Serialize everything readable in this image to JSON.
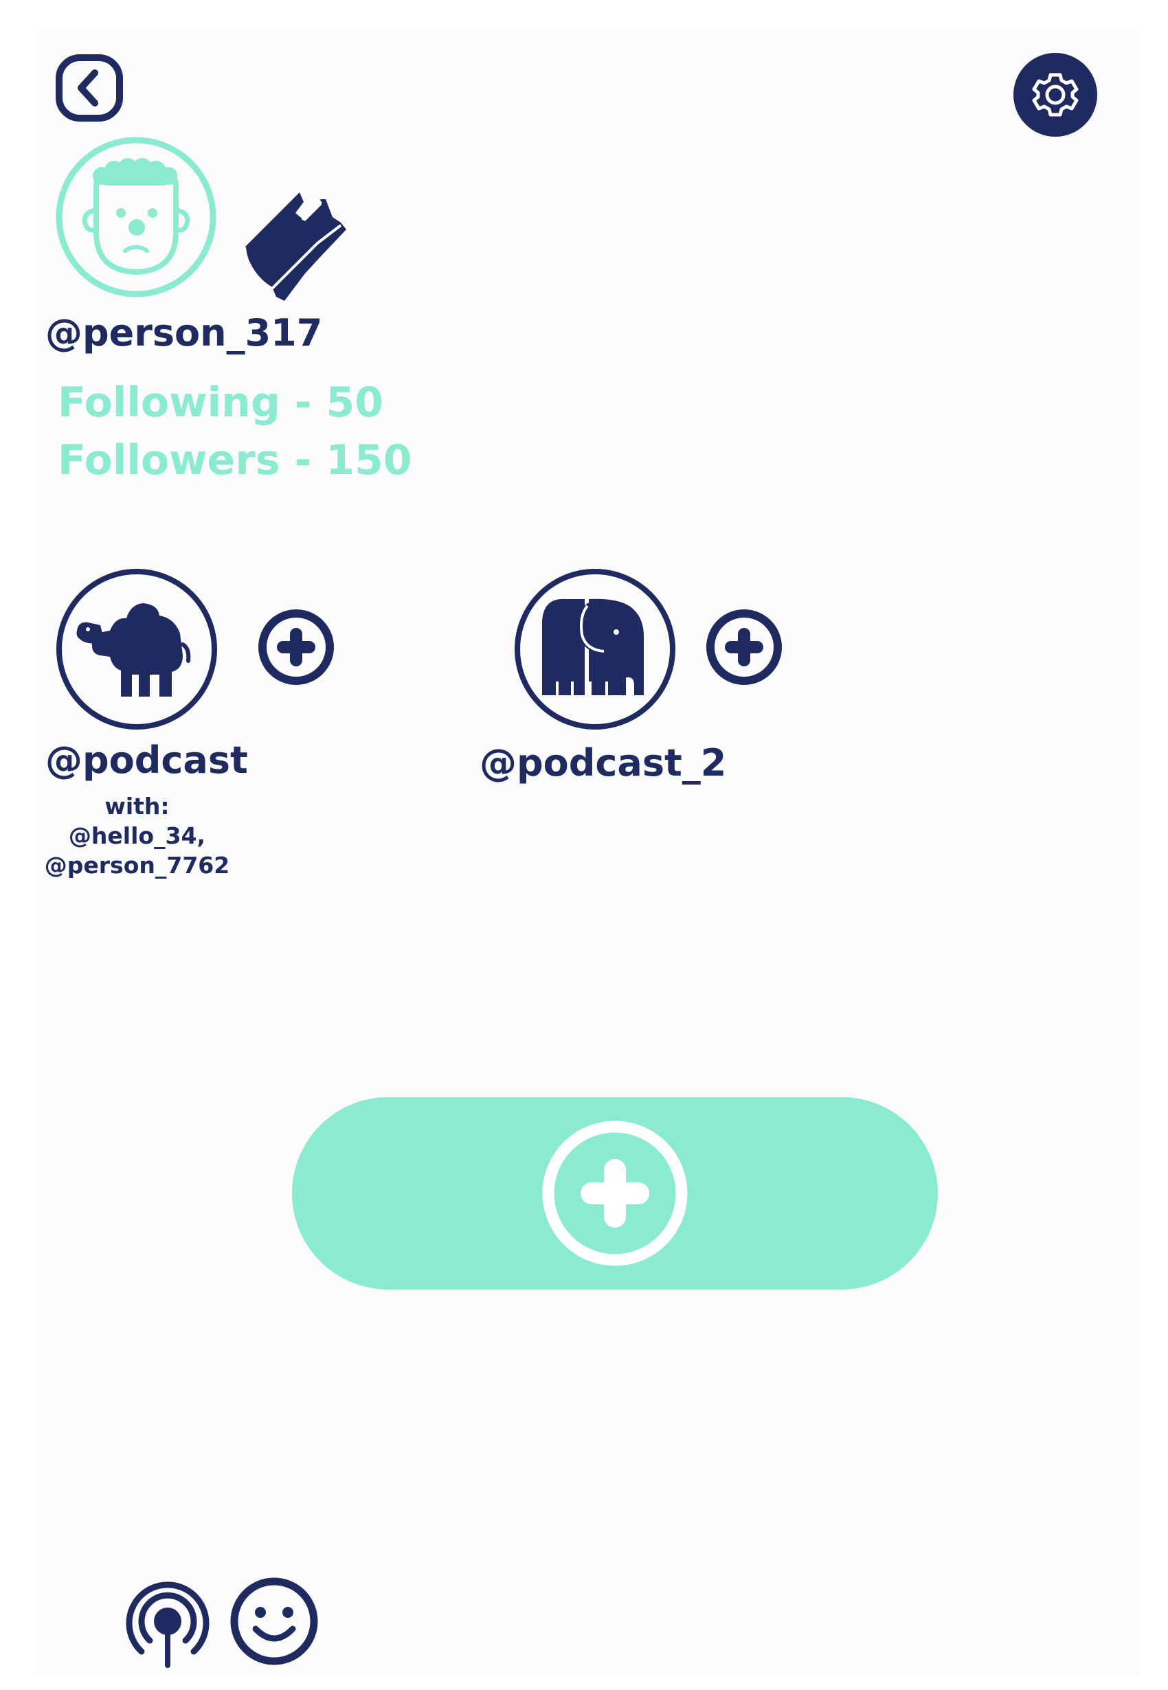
{
  "colors": {
    "navy": "#1f2a60",
    "mint": "#8bebd1",
    "background": "#fbfbfb"
  },
  "header": {
    "back_icon": "chevron-left-icon",
    "settings_icon": "gear-icon"
  },
  "profile": {
    "avatar_icon": "face-icon",
    "badge_icon": "plastic-bag-icon",
    "username": "@person_317",
    "following": "Following - 50",
    "followers": "Followers - 150"
  },
  "podcasts": [
    {
      "icon": "camel-icon",
      "name": "@podcast",
      "with_label": "with:",
      "with_users": [
        "@hello_34,",
        "@person_7762"
      ],
      "action_icon": "plus-circle-icon"
    },
    {
      "icon": "elephant-icon",
      "name": "@podcast_2",
      "action_icon": "plus-circle-icon"
    }
  ],
  "create_button": {
    "icon": "plus-circle-icon"
  },
  "bottom_nav": [
    {
      "icon": "podcast-broadcast-icon"
    },
    {
      "icon": "smiley-icon"
    }
  ]
}
